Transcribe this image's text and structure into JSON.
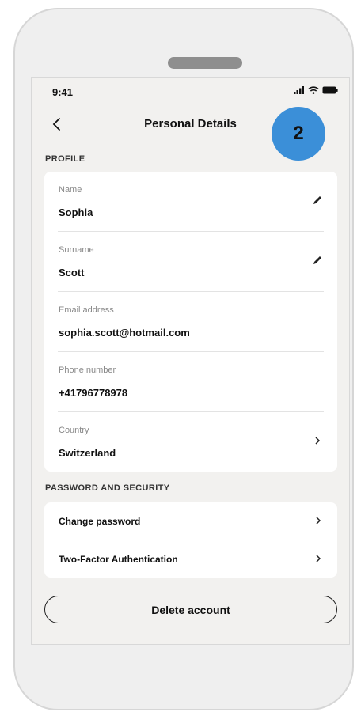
{
  "status_bar": {
    "time": "9:41"
  },
  "header": {
    "title": "Personal Details",
    "step_badge": "2"
  },
  "profile": {
    "section_label": "PROFILE",
    "fields": [
      {
        "label": "Name",
        "value": "Sophia",
        "action": "edit"
      },
      {
        "label": "Surname",
        "value": "Scott",
        "action": "edit"
      },
      {
        "label": "Email address",
        "value": "sophia.scott@hotmail.com",
        "action": "none"
      },
      {
        "label": "Phone number",
        "value": "+41796778978",
        "action": "none"
      },
      {
        "label": "Country",
        "value": "Switzerland",
        "action": "navigate"
      }
    ]
  },
  "security": {
    "section_label": "PASSWORD AND SECURITY",
    "items": [
      {
        "label": "Change password"
      },
      {
        "label": "Two-Factor Authentication"
      }
    ]
  },
  "actions": {
    "delete_label": "Delete account"
  },
  "colors": {
    "badge": "#3b8fd8",
    "screen_bg": "#f2f1ef",
    "card_bg": "#ffffff",
    "phone_frame": "#efefef"
  }
}
